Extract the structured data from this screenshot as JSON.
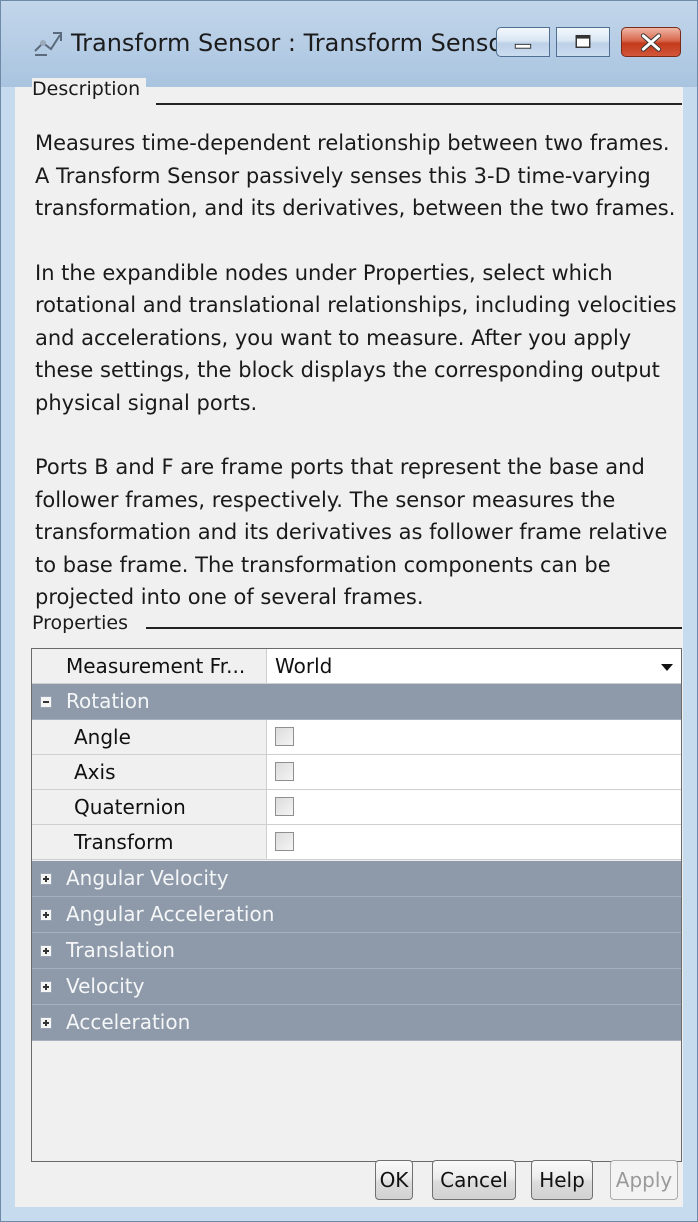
{
  "window": {
    "title": "Transform Sensor : Transform Sensor",
    "icon": "transform-sensor-icon"
  },
  "description": {
    "section_label": "Description",
    "paragraphs": [
      "Measures time-dependent relationship between two frames. A Transform Sensor passively senses this 3-D time-varying transformation, and its derivatives, between the two frames.",
      "In the expandible nodes under Properties, select which rotational and translational relationships, including velocities and accelerations, you want to measure. After you apply these settings, the block displays the corresponding output physical signal ports.",
      "Ports B and F are frame ports that represent the base and follower frames, respectively. The sensor measures the transformation and its derivatives as follower frame relative to base frame. The transformation components can be projected into one of several frames."
    ]
  },
  "properties": {
    "section_label": "Properties",
    "measurement_frame": {
      "label": "Measurement Fr...",
      "value": "World"
    },
    "rotation": {
      "label": "Rotation",
      "expanded": true,
      "items": [
        {
          "label": "Angle",
          "checked": false
        },
        {
          "label": "Axis",
          "checked": false
        },
        {
          "label": "Quaternion",
          "checked": false
        },
        {
          "label": "Transform",
          "checked": false
        }
      ]
    },
    "collapsed_groups": [
      "Angular Velocity",
      "Angular Acceleration",
      "Translation",
      "Velocity",
      "Acceleration"
    ]
  },
  "buttons": {
    "ok": "OK",
    "cancel": "Cancel",
    "help": "Help",
    "apply": "Apply"
  },
  "colors": {
    "title_bar": "#b6cde5",
    "group_row": "#8e9aa9",
    "close_button": "#c33a1b"
  }
}
